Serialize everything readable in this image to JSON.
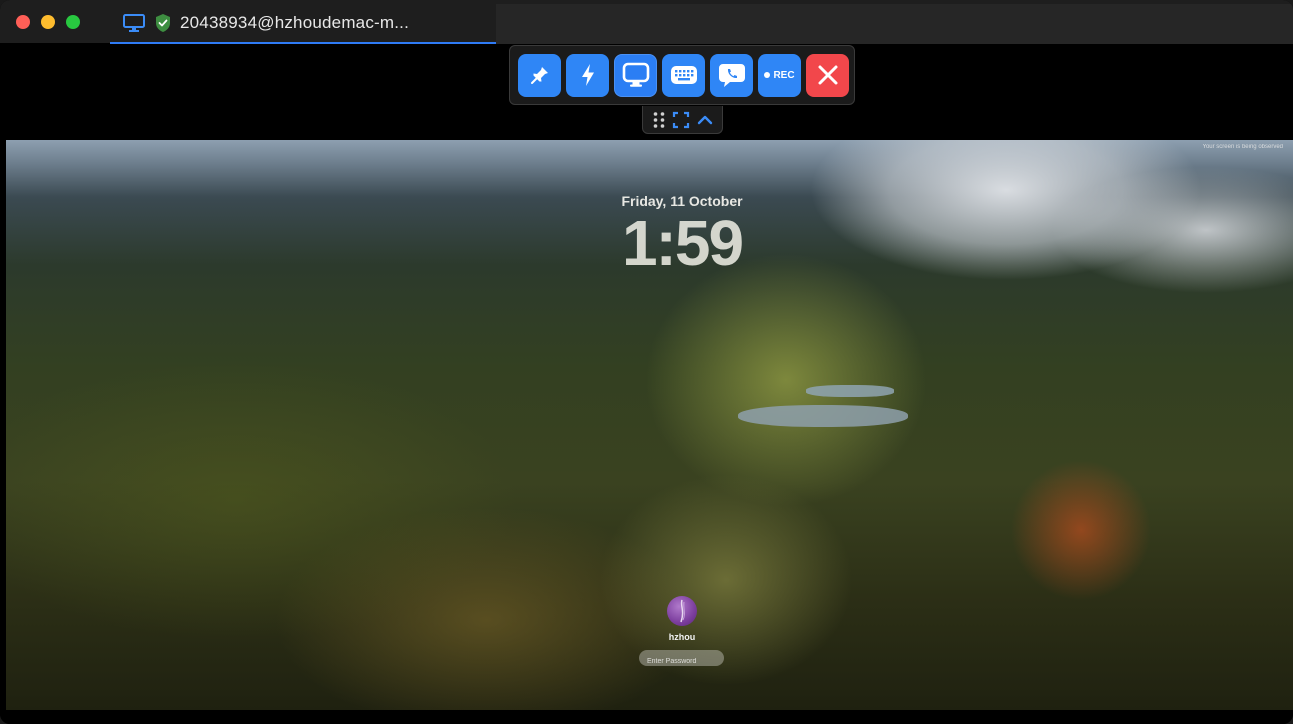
{
  "window": {
    "tab_title": "20438934@hzhoudemac-m..."
  },
  "toolbar": {
    "buttons": [
      {
        "name": "pin-button",
        "icon": "pin-icon"
      },
      {
        "name": "lightning-button",
        "icon": "lightning-icon"
      },
      {
        "name": "display-button",
        "icon": "monitor-icon"
      },
      {
        "name": "keyboard-button",
        "icon": "keyboard-icon"
      },
      {
        "name": "chat-button",
        "icon": "chat-phone-icon"
      },
      {
        "name": "record-button",
        "icon": "record-icon",
        "label": "REC"
      },
      {
        "name": "close-session-button",
        "icon": "close-icon"
      }
    ],
    "accent": "#2f86f6",
    "close_color": "#f2474b"
  },
  "remote": {
    "observed_notice": "Your screen is being observed",
    "date": "Friday, 11 October",
    "time": "1:59",
    "username": "hzhou",
    "password_placeholder": "Enter Password"
  }
}
